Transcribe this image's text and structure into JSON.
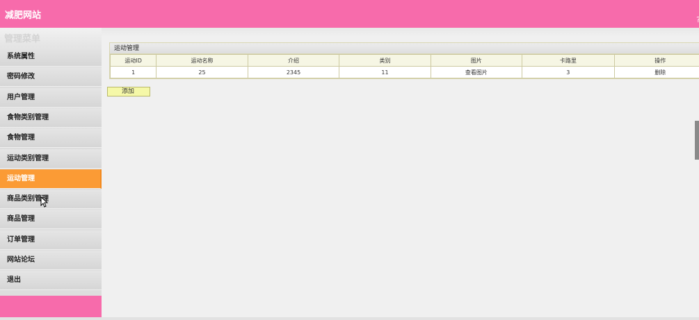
{
  "header": {
    "site_title": "减肥网站",
    "edge_text": "?"
  },
  "sidebar": {
    "menu_title": "管理菜单",
    "items": [
      {
        "label": "系统属性",
        "active": false
      },
      {
        "label": "密码修改",
        "active": false
      },
      {
        "label": "用户管理",
        "active": false
      },
      {
        "label": "食物类别管理",
        "active": false
      },
      {
        "label": "食物管理",
        "active": false
      },
      {
        "label": "运动类别管理",
        "active": false
      },
      {
        "label": "运动管理",
        "active": true
      },
      {
        "label": "商品类别管理",
        "active": false
      },
      {
        "label": "商品管理",
        "active": false
      },
      {
        "label": "订单管理",
        "active": false
      },
      {
        "label": "网站论坛",
        "active": false
      },
      {
        "label": "退出",
        "active": false
      }
    ]
  },
  "main": {
    "panel_title": "运动管理",
    "table": {
      "headers": [
        "运动ID",
        "运动名称",
        "介绍",
        "类别",
        "图片",
        "卡路里",
        "操作"
      ],
      "rows": [
        [
          "1",
          "25",
          "2345",
          "11",
          "查看图片",
          "3",
          "删除"
        ]
      ]
    },
    "add_label": "添加"
  },
  "colors": {
    "header_pink": "#f76bab",
    "active_orange": "#fb9b35",
    "add_button_yellow": "#f5f8a8"
  }
}
